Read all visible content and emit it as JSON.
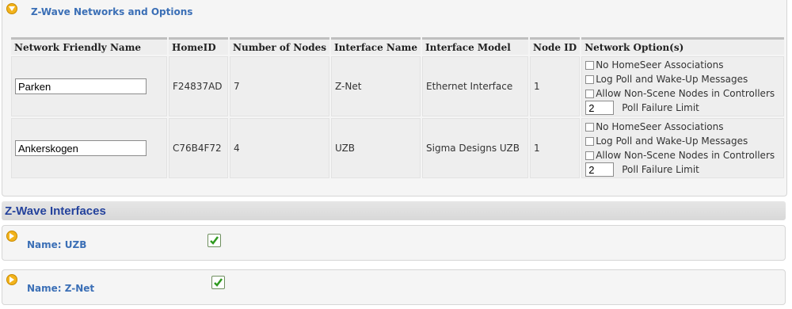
{
  "networks_section": {
    "title": "Z-Wave Networks and Options"
  },
  "table": {
    "headers": [
      "Network Friendly Name",
      "HomeID",
      "Number of Nodes",
      "Interface Name",
      "Interface Model",
      "Node ID",
      "Network Option(s)"
    ],
    "rows": [
      {
        "friendly_name": "Parken",
        "home_id": "F24837AD",
        "num_nodes": "7",
        "interface_name": "Z-Net",
        "interface_model": "Ethernet Interface",
        "node_id": "1",
        "options": [
          "No HomeSeer Associations",
          "Log Poll and Wake-Up Messages",
          "Allow Non-Scene Nodes in Controllers"
        ],
        "poll_failure_value": "2",
        "poll_failure_label": "Poll Failure Limit"
      },
      {
        "friendly_name": "Ankerskogen",
        "home_id": "C76B4F72",
        "num_nodes": "4",
        "interface_name": "UZB",
        "interface_model": "Sigma Designs UZB",
        "node_id": "1",
        "options": [
          "No HomeSeer Associations",
          "Log Poll and Wake-Up Messages",
          "Allow Non-Scene Nodes in Controllers"
        ],
        "poll_failure_value": "2",
        "poll_failure_label": "Poll Failure Limit"
      }
    ]
  },
  "interfaces_section": {
    "title": "Z-Wave Interfaces",
    "items": [
      {
        "label": "Name: UZB",
        "enabled": true
      },
      {
        "label": "Name: Z-Net",
        "enabled": true
      }
    ]
  },
  "colors": {
    "accent": "#f2b31c",
    "link_blue": "#3b6fb6",
    "header_blue": "#24429c",
    "check_green": "#2f9a1f"
  }
}
